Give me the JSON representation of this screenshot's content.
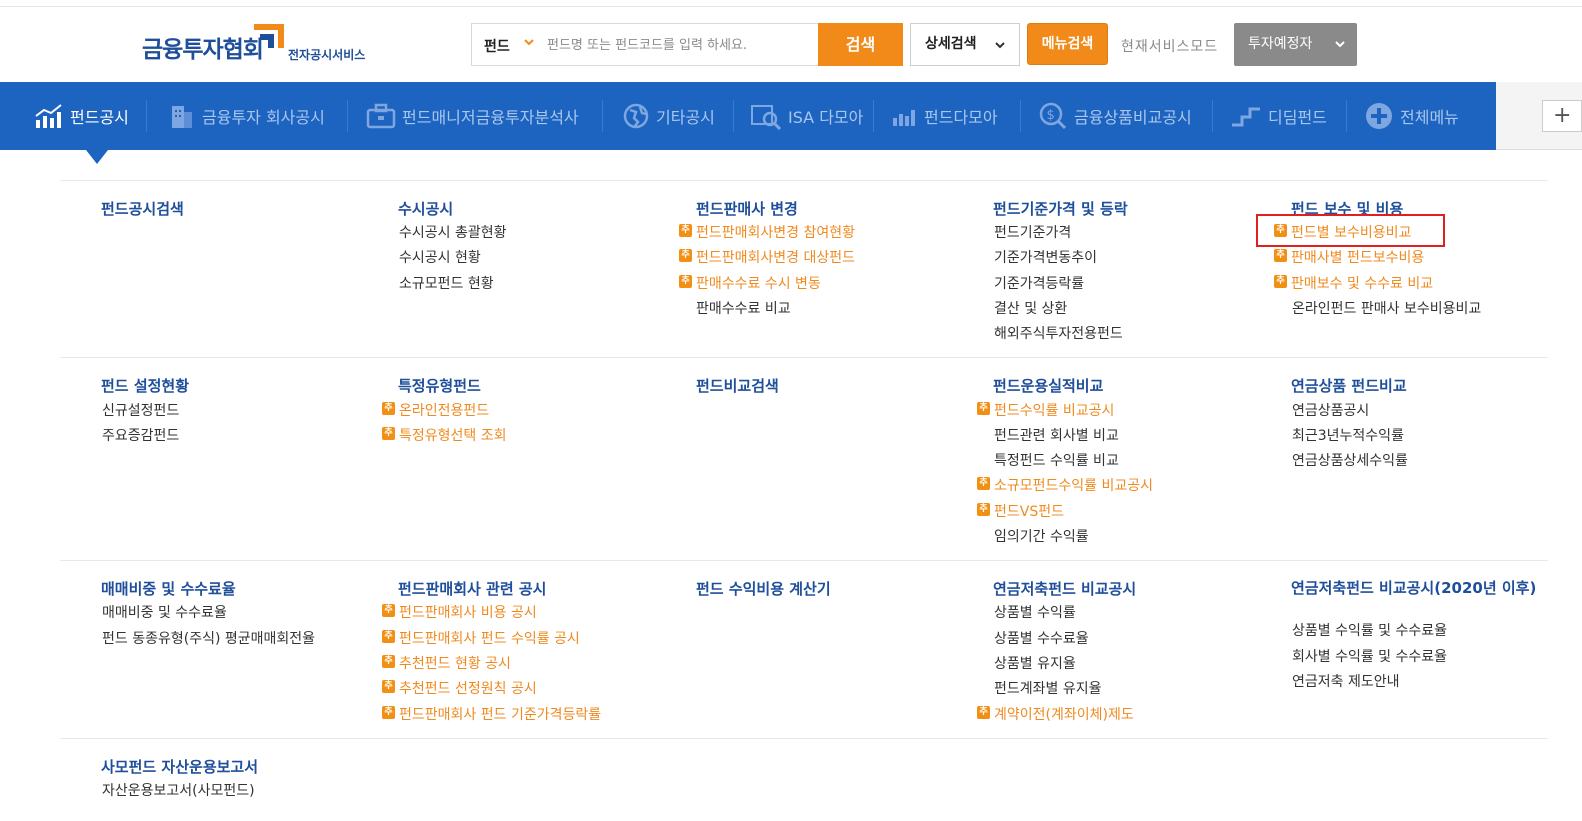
{
  "header": {
    "logo_main": "금융투자협회",
    "logo_sub": "전자공시서비스",
    "search_category": "펀드",
    "search_placeholder": "펀드명 또는 펀드코드를 입력 하세요.",
    "search_button": "검색",
    "detail_search": "상세검색",
    "menu_search": "메뉴검색",
    "mode_label": "현재서비스모드",
    "mode_value": "투자예정자",
    "accent_color": "#f28a1a",
    "brand_color": "#1f4e9a"
  },
  "nav": {
    "items": [
      {
        "label": "펀드공시",
        "icon": "chart-up-icon",
        "active": true
      },
      {
        "label": "금융투자 회사공시",
        "icon": "building-icon"
      },
      {
        "label": "펀드매니저금융투자분석사",
        "icon": "briefcase-icon"
      },
      {
        "label": "기타공시",
        "icon": "globe-icon"
      },
      {
        "label": "ISA 다모아",
        "icon": "isa-search-icon"
      },
      {
        "label": "펀드다모아",
        "icon": "bar-chart-icon"
      },
      {
        "label": "금융상품비교공시",
        "icon": "coin-search-icon"
      },
      {
        "label": "디딤펀드",
        "icon": "step-icon"
      },
      {
        "label": "전체메뉴",
        "icon": "plus-circle-icon"
      }
    ],
    "extra_button": "+",
    "bar_color": "#1d64c0"
  },
  "badge_text": "추",
  "menu": {
    "r1": {
      "c1": {
        "title": "펀드공시검색",
        "items": []
      },
      "c2": {
        "title": "수시공시",
        "items": [
          "수시공시 총괄현황",
          "수시공시 현황",
          "소규모펀드 현황"
        ]
      },
      "c3": {
        "title": "펀드판매사 변경",
        "items": [
          "펀드판매회사변경 참여현황",
          "펀드판매회사변경 대상펀드",
          "판매수수료 수시 변동",
          "판매수수료 비교"
        ]
      },
      "c4": {
        "title": "펀드기준가격 및 등락",
        "items": [
          "펀드기준가격",
          "기준가격변동추이",
          "기준가격등락률",
          "결산 및 상환",
          "해외주식투자전용펀드"
        ]
      },
      "c5": {
        "title": "펀드 보수 및 비용",
        "items": [
          "펀드별 보수비용비교",
          "판매사별 펀드보수비용",
          "판매보수 및 수수료 비교",
          "온라인펀드 판매사 보수비용비교"
        ]
      }
    },
    "r2": {
      "c1": {
        "title": "펀드 설정현황",
        "items": [
          "신규설정펀드",
          "주요증감펀드"
        ]
      },
      "c2": {
        "title": "특정유형펀드",
        "items": [
          "온라인전용펀드",
          "특정유형선택 조회"
        ]
      },
      "c3": {
        "title": "펀드비교검색",
        "items": []
      },
      "c4": {
        "title": "펀드운용실적비교",
        "items": [
          "펀드수익률 비교공시",
          "펀드관련 회사별 비교",
          "특정펀드 수익률 비교",
          "소규모펀드수익률 비교공시",
          "펀드VS펀드",
          "임의기간 수익률"
        ]
      },
      "c5": {
        "title": "연금상품 펀드비교",
        "items": [
          "연금상품공시",
          "최근3년누적수익률",
          "연금상품상세수익률"
        ]
      }
    },
    "r3": {
      "c1": {
        "title": "매매비중 및 수수료율",
        "items": [
          "매매비중 및 수수료율",
          "펀드 동종유형(주식) 평균매매회전율"
        ]
      },
      "c2": {
        "title": "펀드판매회사 관련 공시",
        "items": [
          "펀드판매회사 비용 공시",
          "펀드판매회사 펀드 수익률 공시",
          "추천펀드 현황 공시",
          "추천펀드 선정원칙 공시",
          "펀드판매회사 펀드 기준가격등락률"
        ]
      },
      "c3": {
        "title": "펀드 수익비용 계산기",
        "items": []
      },
      "c4": {
        "title": "연금저축펀드 비교공시",
        "items": [
          "상품별 수익률",
          "상품별 수수료율",
          "상품별 유지율",
          "펀드계좌별 유지율",
          "계약이전(계좌이체)제도"
        ]
      },
      "c5": {
        "title": "연금저축펀드 비교공시(2020년 이후)",
        "items": [
          "상품별 수익률 및 수수료율",
          "회사별 수익률 및 수수료율",
          "연금저축 제도안내"
        ]
      }
    },
    "r4": {
      "c1": {
        "title": "사모펀드 자산운용보고서",
        "items": [
          "자산운용보고서(사모펀드)"
        ]
      }
    }
  }
}
